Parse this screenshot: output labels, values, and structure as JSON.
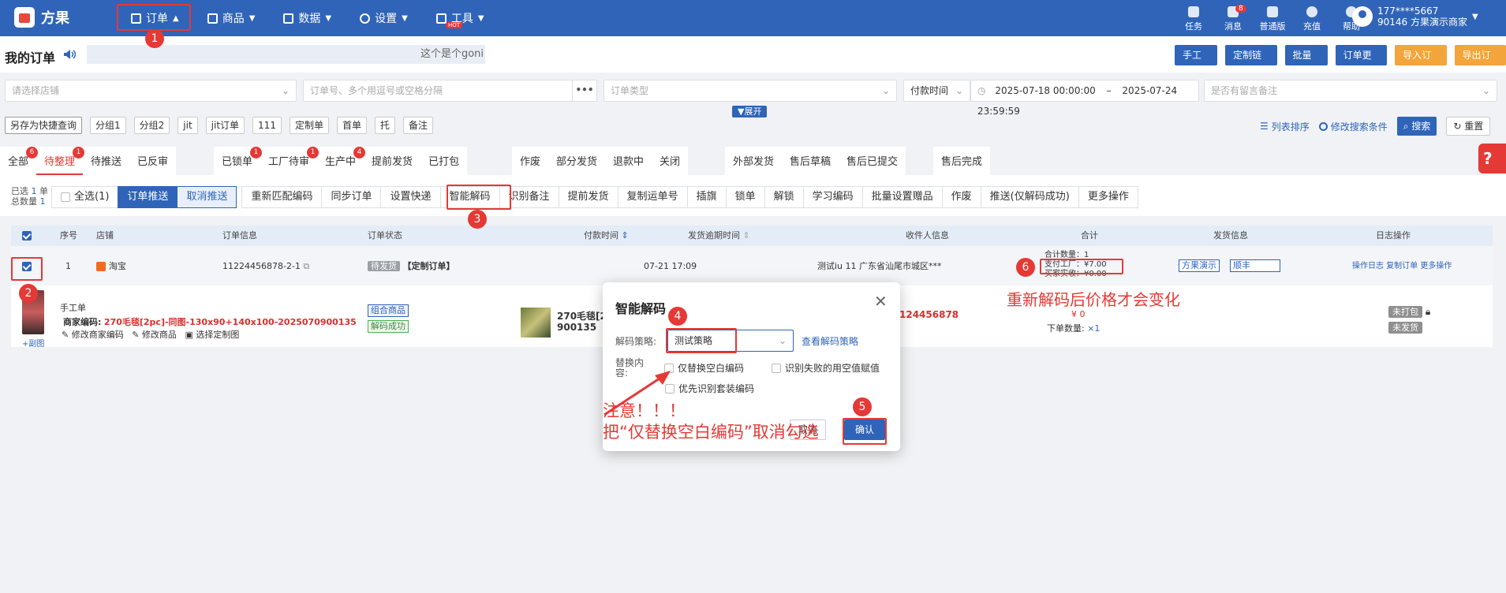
{
  "app": {
    "name": "方果"
  },
  "nav": [
    {
      "label": "订单",
      "icon": "order-icon"
    },
    {
      "label": "商品",
      "icon": "goods-icon"
    },
    {
      "label": "数据",
      "icon": "chart-icon"
    },
    {
      "label": "设置",
      "icon": "gear-icon"
    },
    {
      "label": "工具",
      "icon": "tool-icon",
      "badge": "HOT"
    }
  ],
  "right_tools": [
    {
      "label": "任务",
      "badge": ""
    },
    {
      "label": "消息",
      "badge": "8"
    },
    {
      "label": "普通版",
      "badge": ""
    },
    {
      "label": "充值",
      "badge": ""
    },
    {
      "label": "帮助",
      "badge": ""
    }
  ],
  "user": {
    "phone": "177****5667",
    "shop": "90146 方果演示商家"
  },
  "page": {
    "title": "我的订单",
    "marquee": "这个是个goni",
    "actions": [
      {
        "label": "手工单",
        "style": "blue"
      },
      {
        "label": "定制链接",
        "style": "blue"
      },
      {
        "label": "批量单",
        "style": "blue"
      },
      {
        "label": "订单更新",
        "style": "blue"
      },
      {
        "label": "导入订单",
        "style": "orange"
      },
      {
        "label": "导出订单",
        "style": "orange"
      }
    ]
  },
  "filters": {
    "shop_placeholder": "请选择店铺",
    "order_no_placeholder": "订单号、多个用逗号或空格分隔",
    "order_type_placeholder": "订单类型",
    "time_type": "付款时间",
    "date_start": "2025-07-18 00:00:00",
    "date_sep": "–",
    "date_end": "2025-07-24 23:59:59",
    "remark_placeholder": "是否有留言备注",
    "expand": "▼展开"
  },
  "quick_tags": [
    "另存为快捷查询",
    "分组1",
    "分组2",
    "jit",
    "jit订单",
    "111",
    "定制单",
    "首单",
    "托",
    "备注"
  ],
  "search_links": {
    "sort": "列表排序",
    "modify": "修改搜索条件",
    "search": "搜索",
    "reset": "重置"
  },
  "status_tabs": [
    [
      {
        "label": "全部",
        "badge": "6"
      },
      {
        "label": "待整理",
        "badge": "1",
        "active": true
      },
      {
        "label": "待推送",
        "badge": ""
      },
      {
        "label": "已反审",
        "badge": ""
      }
    ],
    [
      {
        "label": "已锁单",
        "badge": "1"
      },
      {
        "label": "工厂待审",
        "badge": "1"
      },
      {
        "label": "生产中",
        "badge": "4"
      },
      {
        "label": "提前发货",
        "badge": ""
      },
      {
        "label": "已打包",
        "badge": ""
      }
    ],
    [
      {
        "label": "作废",
        "badge": ""
      },
      {
        "label": "部分发货",
        "badge": ""
      },
      {
        "label": "退款中",
        "badge": ""
      },
      {
        "label": "关闭",
        "badge": ""
      }
    ],
    [
      {
        "label": "外部发货",
        "badge": ""
      },
      {
        "label": "售后草稿",
        "badge": ""
      },
      {
        "label": "售后已提交",
        "badge": ""
      }
    ],
    [
      {
        "label": "售后完成",
        "badge": ""
      }
    ]
  ],
  "batch": {
    "selected_label": "已选",
    "selected": "1",
    "selected_unit": "单",
    "total_label": "总数量",
    "total": "1",
    "select_all": "全选(1)",
    "buttons": [
      "订单推送",
      "取消推送",
      "重新匹配编码",
      "同步订单",
      "设置快递",
      "智能解码",
      "识别备注",
      "提前发货",
      "复制运单号",
      "插旗",
      "锁单",
      "解锁",
      "学习编码",
      "批量设置赠品",
      "作废",
      "推送(仅解码成功)",
      "更多操作"
    ]
  },
  "table": {
    "headers": {
      "index": "序号",
      "shop": "店铺",
      "order_info": "订单信息",
      "order_status": "订单状态",
      "pay_time": "付款时间",
      "ship_deadline": "发货逾期时间",
      "receiver": "收件人信息",
      "total": "合计",
      "ship_info": "发货信息",
      "log": "日志操作"
    },
    "row": {
      "index": "1",
      "shop": "淘宝",
      "order_no": "11224456878-2-1",
      "status_badge": "待发货",
      "status_type": "【定制订单】",
      "deadline": "07-21 17:09",
      "receiver": "测试iu  11  广东省汕尾市城区***",
      "total_qty": "合计数量：1",
      "pay_factory": "支付工厂：¥7.00",
      "buyer_paid": "买家实收：¥0.00",
      "ship_template": "方果演示",
      "courier": "顺丰",
      "log_links": [
        "操作日志",
        "复制订单",
        "更多操作"
      ]
    },
    "detail": {
      "type": "手工单",
      "merchant_code_label": "商家编码:",
      "merchant_code": "270毛毯[2pc]-同图-130x90+140x100-2025070900135",
      "actions": [
        "修改商家编码",
        "修改商品",
        "选择定制图"
      ],
      "swap_link": "+副图",
      "tag1": "组合商品",
      "tag2": "解码成功",
      "product_name": "270毛毯[2",
      "product_code": "900135",
      "order_tail": "124456878",
      "price": "¥ 0",
      "order_qty_label": "下单数量:",
      "order_qty": "×1",
      "badge_unpacked": "未打包",
      "badge_unshipped": "未发货"
    }
  },
  "modal": {
    "title": "智能解码",
    "strategy_label": "解码策略:",
    "strategy_value": "测试策略",
    "view_link": "查看解码策略",
    "replace_label": "替换内容:",
    "opt1": "仅替换空白编码",
    "opt2": "识别失败的用空值赋值",
    "opt3": "优先识别套装编码",
    "cancel": "取消",
    "confirm": "确认"
  },
  "annotations": {
    "numbers": [
      "1",
      "2",
      "3",
      "4",
      "5",
      "6"
    ],
    "note_line1": "注意！！！",
    "note_line2": "把“仅替换空白编码”取消勾选",
    "note_price": "重新解码后价格才会变化",
    "color": "#e53935"
  }
}
